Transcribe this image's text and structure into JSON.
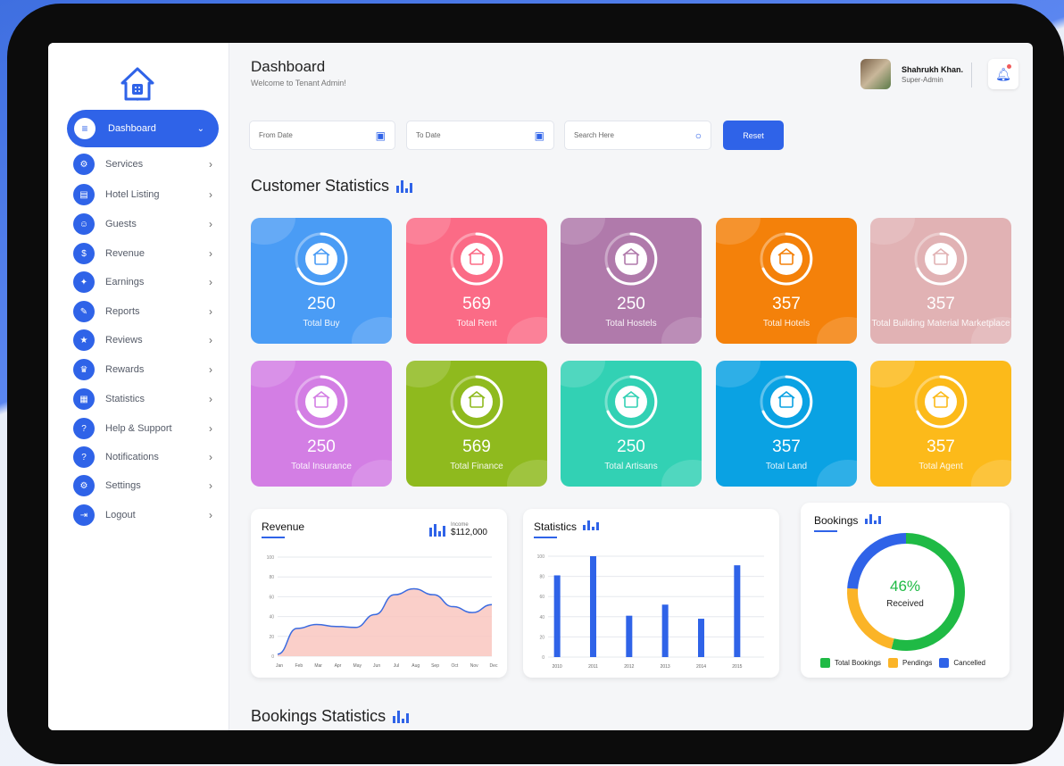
{
  "header": {
    "title": "Dashboard",
    "subtitle": "Welcome to Tenant Admin!"
  },
  "user": {
    "name": "Shahrukh Khan.",
    "role": "Super-Admin"
  },
  "sidebar": {
    "active": {
      "label": "Dashboard"
    },
    "items": [
      {
        "label": "Services",
        "icon": "services-icon"
      },
      {
        "label": "Hotel Listing",
        "icon": "hotel-icon"
      },
      {
        "label": "Guests",
        "icon": "guests-icon"
      },
      {
        "label": "Revenue",
        "icon": "revenue-icon"
      },
      {
        "label": "Earnings",
        "icon": "earnings-icon"
      },
      {
        "label": "Reports",
        "icon": "reports-icon"
      },
      {
        "label": "Reviews",
        "icon": "reviews-icon"
      },
      {
        "label": "Rewards",
        "icon": "rewards-icon"
      },
      {
        "label": "Statistics",
        "icon": "statistics-icon"
      },
      {
        "label": "Help & Support",
        "icon": "help-icon"
      },
      {
        "label": "Notifications",
        "icon": "notifications-icon"
      },
      {
        "label": "Settings",
        "icon": "settings-icon"
      },
      {
        "label": "Logout",
        "icon": "logout-icon"
      }
    ]
  },
  "filters": {
    "from_date": "From Date",
    "to_date": "To Date",
    "search": "Search Here",
    "reset": "Reset"
  },
  "sections": {
    "customer_statistics": "Customer Statistics",
    "bookings_statistics": "Bookings Statistics"
  },
  "cards": [
    {
      "value": "250",
      "label": "Total Buy",
      "color": "#4a9cf5"
    },
    {
      "value": "569",
      "label": "Total Rent",
      "color": "#fb6b86"
    },
    {
      "value": "250",
      "label": "Total Hostels",
      "color": "#b07aab"
    },
    {
      "value": "357",
      "label": "Total Hotels",
      "color": "#f4810a"
    },
    {
      "value": "357",
      "label": "Total Building Material Marketplace",
      "color": "#e1b2b4"
    },
    {
      "value": "250",
      "label": "Total Insurance",
      "color": "#d37ee4"
    },
    {
      "value": "569",
      "label": "Total Finance",
      "color": "#8fba1e"
    },
    {
      "value": "250",
      "label": "Total Artisans",
      "color": "#32d1b4"
    },
    {
      "value": "357",
      "label": "Total Land",
      "color": "#0aa2e3"
    },
    {
      "value": "357",
      "label": "Total Agent",
      "color": "#fcba1a"
    }
  ],
  "revenue": {
    "title": "Revenue",
    "income_label": "Income",
    "income_value": "$112,000"
  },
  "statistics": {
    "title": "Statistics"
  },
  "bookings": {
    "title": "Bookings",
    "percent": "46%",
    "caption": "Received"
  },
  "chart_data": [
    {
      "type": "area",
      "title": "Revenue",
      "categories": [
        "Jan",
        "Feb",
        "Mar",
        "Apr",
        "May",
        "Jun",
        "Jul",
        "Aug",
        "Sep",
        "Oct",
        "Nov",
        "Dec"
      ],
      "values": [
        2,
        28,
        32,
        30,
        29,
        42,
        62,
        68,
        62,
        50,
        44,
        52
      ],
      "yticks": [
        "0",
        "20",
        "40",
        "60",
        "80",
        "100"
      ],
      "ylim": [
        0,
        100
      ],
      "color": "#3b6be0",
      "fill": "#f9c7c0"
    },
    {
      "type": "bar",
      "title": "Statistics",
      "categories": [
        "2010",
        "2011",
        "2012",
        "2013",
        "2014",
        "2015"
      ],
      "values": [
        81,
        100,
        41,
        52,
        38,
        91
      ],
      "yticks": [
        "0",
        "20",
        "40",
        "60",
        "80",
        "100"
      ],
      "ylim": [
        0,
        100
      ],
      "color": "#2f63e8"
    },
    {
      "type": "pie",
      "title": "Bookings",
      "series": [
        {
          "name": "Total Bookings",
          "value": 54,
          "color": "#1fba45"
        },
        {
          "name": "Pendings",
          "value": 22,
          "color": "#fbb427"
        },
        {
          "name": "Cancelled",
          "value": 24,
          "color": "#2f63e8"
        }
      ]
    }
  ]
}
